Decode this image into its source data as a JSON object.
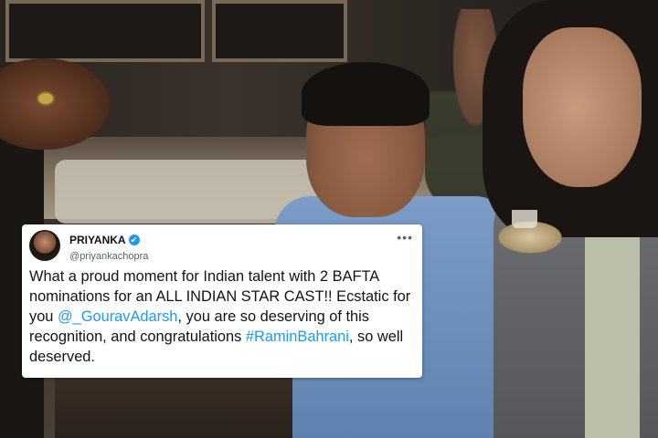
{
  "tweet": {
    "display_name": "PRIYANKA",
    "verified_symbol": "✔",
    "handle": "@priyankachopra",
    "more_symbol": "•••",
    "text_part1": "What a proud moment for Indian talent with 2 BAFTA nominations for an ALL INDIAN STAR CAST!! Ecstatic for you ",
    "mention": "@_GouravAdarsh",
    "text_part2": ", you are so deserving of this recognition, and congratulations ",
    "hashtag": "#RaminBahrani",
    "text_part3": ", so well deserved."
  },
  "colors": {
    "link": "#1d9bf0",
    "text": "#0f1419",
    "muted": "#536471",
    "card": "#ffffff"
  },
  "icons": {
    "verified": "verified-badge-icon",
    "more": "more-options-icon"
  }
}
